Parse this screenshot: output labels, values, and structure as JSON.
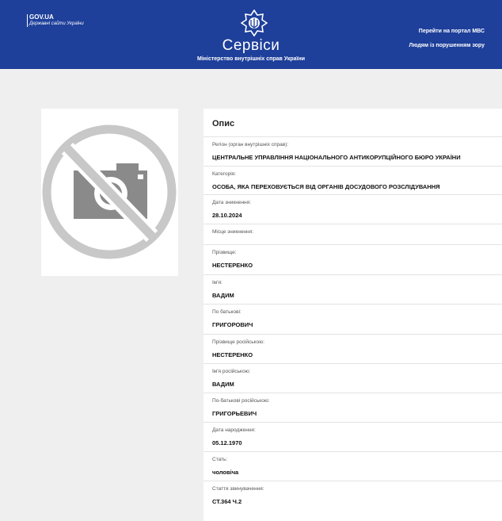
{
  "header": {
    "gov_title": "GOV.UA",
    "gov_subtitle": "Державні сайти України",
    "title": "Сервіси",
    "subtitle": "Міністерство внутрішніх справ України",
    "link_portal": "Перейти на портал МВС",
    "link_vision": "Людям із порушенням зору"
  },
  "colors": {
    "header_bg": "#1e3f9a",
    "page_bg": "#efefef",
    "placeholder_grey": "#c8c8c8",
    "camera_grey": "#8a8a8a"
  },
  "photo": {
    "icon": "no-photo-icon"
  },
  "card": {
    "title": "Опис",
    "fields": [
      {
        "label": "Регіон (орган внутрішніх справ):",
        "value": "ЦЕНТРАЛЬНЕ УПРАВЛІННЯ НАЦІОНАЛЬНОГО АНТИКОРУПЦІЙНОГО БЮРО УКРАЇНИ"
      },
      {
        "label": "Категорія:",
        "value": "ОСОБА, ЯКА ПЕРЕХОВУЄТЬСЯ ВІД ОРГАНІВ ДОСУДОВОГО РОЗСЛІДУВАННЯ"
      },
      {
        "label": "Дата зникнення:",
        "value": "28.10.2024"
      },
      {
        "label": "Місце зникнення:",
        "value": ""
      },
      {
        "label": "Прізвище:",
        "value": "НЕСТЕРЕНКО"
      },
      {
        "label": "Ім'я:",
        "value": "ВАДИМ"
      },
      {
        "label": "По батькові:",
        "value": "ГРИГОРОВИЧ"
      },
      {
        "label": "Прізвище російською:",
        "value": "НЕСТЕРЕНКО"
      },
      {
        "label": "Ім'я російською:",
        "value": "ВАДИМ"
      },
      {
        "label": "По-батькові російською:",
        "value": "ГРИГОРЬЕВИЧ"
      },
      {
        "label": "Дата народження:",
        "value": "05.12.1970"
      },
      {
        "label": "Стать:",
        "value": "чоловіча"
      },
      {
        "label": "Стаття звинувачення:",
        "value": "СТ.364 Ч.2"
      }
    ]
  }
}
